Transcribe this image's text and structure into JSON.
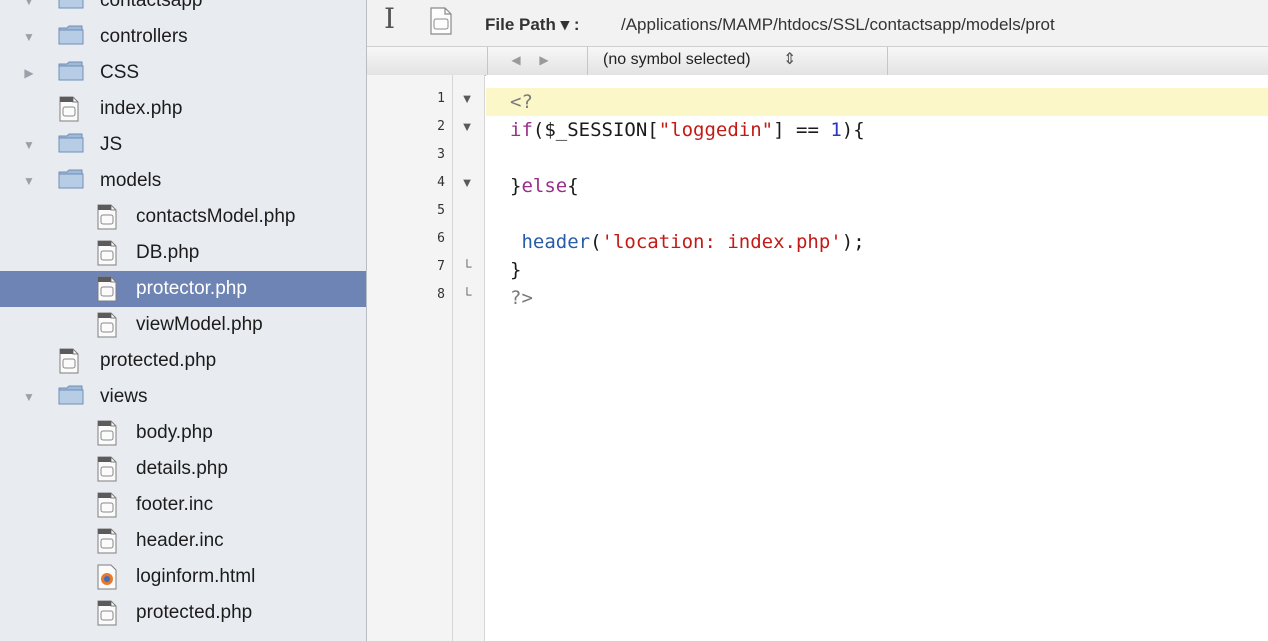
{
  "sidebar": {
    "items": [
      {
        "label": "contactsapp",
        "kind": "project",
        "depth": 0,
        "expanded": true
      },
      {
        "label": "controllers",
        "kind": "folder",
        "depth": 1,
        "expanded": true
      },
      {
        "label": "CSS",
        "kind": "folder",
        "depth": 1,
        "expanded": false
      },
      {
        "label": "index.php",
        "kind": "file",
        "depth": 1
      },
      {
        "label": "JS",
        "kind": "folder",
        "depth": 1,
        "expanded": true
      },
      {
        "label": "models",
        "kind": "folder",
        "depth": 1,
        "expanded": true
      },
      {
        "label": "contactsModel.php",
        "kind": "file",
        "depth": 2
      },
      {
        "label": "DB.php",
        "kind": "file",
        "depth": 2
      },
      {
        "label": "protector.php",
        "kind": "file",
        "depth": 2,
        "selected": true
      },
      {
        "label": "viewModel.php",
        "kind": "file",
        "depth": 2
      },
      {
        "label": "protected.php",
        "kind": "file",
        "depth": 1
      },
      {
        "label": "views",
        "kind": "folder",
        "depth": 1,
        "expanded": true
      },
      {
        "label": "body.php",
        "kind": "file",
        "depth": 2
      },
      {
        "label": "details.php",
        "kind": "file",
        "depth": 2
      },
      {
        "label": "footer.inc",
        "kind": "file",
        "depth": 2
      },
      {
        "label": "header.inc",
        "kind": "file",
        "depth": 2
      },
      {
        "label": "loginform.html",
        "kind": "html",
        "depth": 2
      },
      {
        "label": "protected.php",
        "kind": "file",
        "depth": 2
      }
    ],
    "selection_color": "#6d84b4"
  },
  "toolbar": {
    "path_label": "File Path ▾ :",
    "path_value": "/Applications/MAMP/htdocs/SSL/contactsapp/models/prot"
  },
  "jumpbar": {
    "back_icon": "triangle-left-icon",
    "forward_icon": "triangle-right-icon",
    "symbol_label": "(no symbol selected)",
    "updown_icon": "updown-icon"
  },
  "gutter": {
    "line_numbers": [
      "1",
      "2",
      "3",
      "4",
      "5",
      "6",
      "7",
      "8"
    ],
    "fold_markers": [
      "▼",
      "▼",
      "",
      "▼",
      "",
      "",
      "└",
      "└"
    ]
  },
  "code": {
    "current_line_color": "#fbf7c8",
    "lines": [
      [
        {
          "t": "<?",
          "c": "php"
        }
      ],
      [
        {
          "t": "if",
          "c": "kw"
        },
        {
          "t": "($_SESSION[",
          "c": "plain"
        },
        {
          "t": "\"loggedin\"",
          "c": "str"
        },
        {
          "t": "] == ",
          "c": "plain"
        },
        {
          "t": "1",
          "c": "num"
        },
        {
          "t": "){",
          "c": "plain"
        }
      ],
      [],
      [
        {
          "t": "}",
          "c": "plain"
        },
        {
          "t": "else",
          "c": "kw"
        },
        {
          "t": "{",
          "c": "plain"
        }
      ],
      [],
      [
        {
          "t": " header",
          "c": "fn"
        },
        {
          "t": "(",
          "c": "plain"
        },
        {
          "t": "'location: index.php'",
          "c": "str"
        },
        {
          "t": ");",
          "c": "plain"
        }
      ],
      [
        {
          "t": "}",
          "c": "plain"
        }
      ],
      [
        {
          "t": "?>",
          "c": "php"
        }
      ]
    ]
  }
}
